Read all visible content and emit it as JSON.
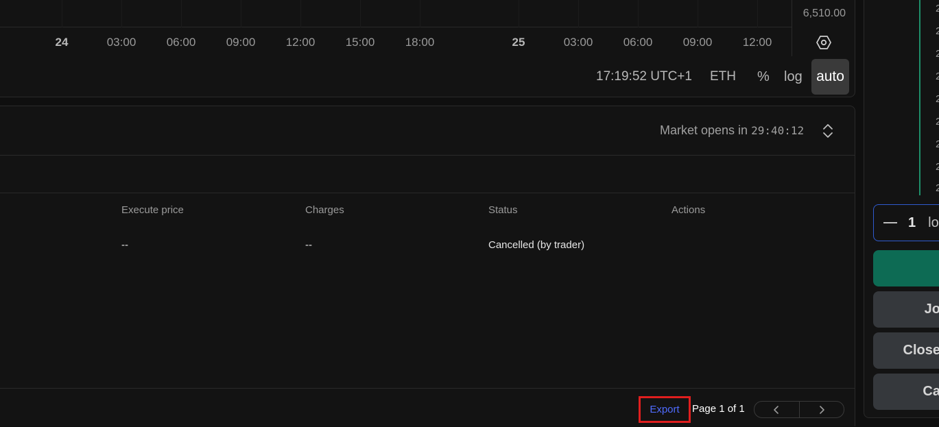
{
  "chart": {
    "price_label": "6,510.00",
    "time_ticks": [
      {
        "label": "24",
        "day": true
      },
      {
        "label": "03:00",
        "day": false
      },
      {
        "label": "06:00",
        "day": false
      },
      {
        "label": "09:00",
        "day": false
      },
      {
        "label": "12:00",
        "day": false
      },
      {
        "label": "15:00",
        "day": false
      },
      {
        "label": "18:00",
        "day": false
      },
      {
        "label": "25",
        "day": true
      },
      {
        "label": "03:00",
        "day": false
      },
      {
        "label": "06:00",
        "day": false
      },
      {
        "label": "09:00",
        "day": false
      },
      {
        "label": "12:00",
        "day": false
      }
    ],
    "footer": {
      "clock": "17:19:52 UTC+1",
      "session": "ETH",
      "percent": "%",
      "log": "log",
      "auto": "auto"
    }
  },
  "orders": {
    "market_status_label": "Market opens in",
    "market_countdown": "29:40:12",
    "columns": [
      "Execute price",
      "Charges",
      "Status",
      "Actions"
    ],
    "rows": [
      {
        "execute_price": "--",
        "charges": "--",
        "status": "Cancelled (by trader)",
        "actions": ""
      }
    ],
    "export_label": "Export",
    "page_text": "Page 1 of 1"
  },
  "right_panel": {
    "qty_value": "1",
    "qty_unit": "lot",
    "buttons": {
      "primary": "",
      "second": "Jo",
      "third": "Close",
      "fourth": "Ca"
    },
    "accent_colors": {
      "buy": "#0d6b54",
      "depth_line": "#1f8f6a",
      "focus_border": "#2f5bd0",
      "highlight": "#e01e1e",
      "link": "#4f6bff"
    }
  }
}
